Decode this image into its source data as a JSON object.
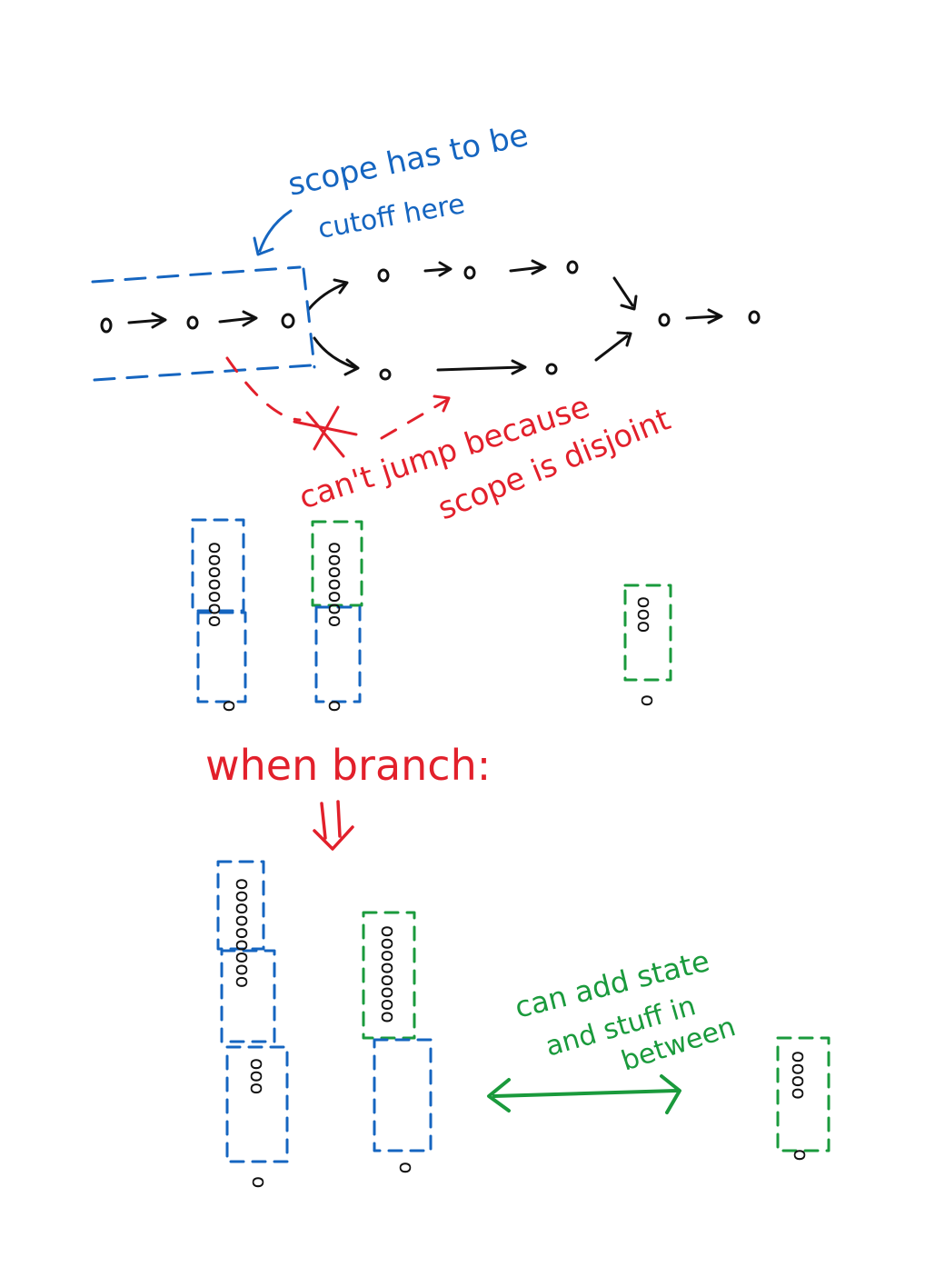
{
  "colors": {
    "black": "#111111",
    "blue": "#1565c0",
    "red": "#e2202b",
    "green": "#1a9a3c"
  },
  "annotations": {
    "scope_line1": "scope has to be",
    "scope_line2": "cutoff here",
    "cant_jump_line1": "can't jump because",
    "cant_jump_line2": "scope is disjoint",
    "when_branch": "when branch:",
    "add_state_line1": "can add state",
    "add_state_line2": "and stuff in",
    "add_state_line3": "between"
  },
  "symbols": {
    "node": "o",
    "down_arrow": "⇓"
  }
}
